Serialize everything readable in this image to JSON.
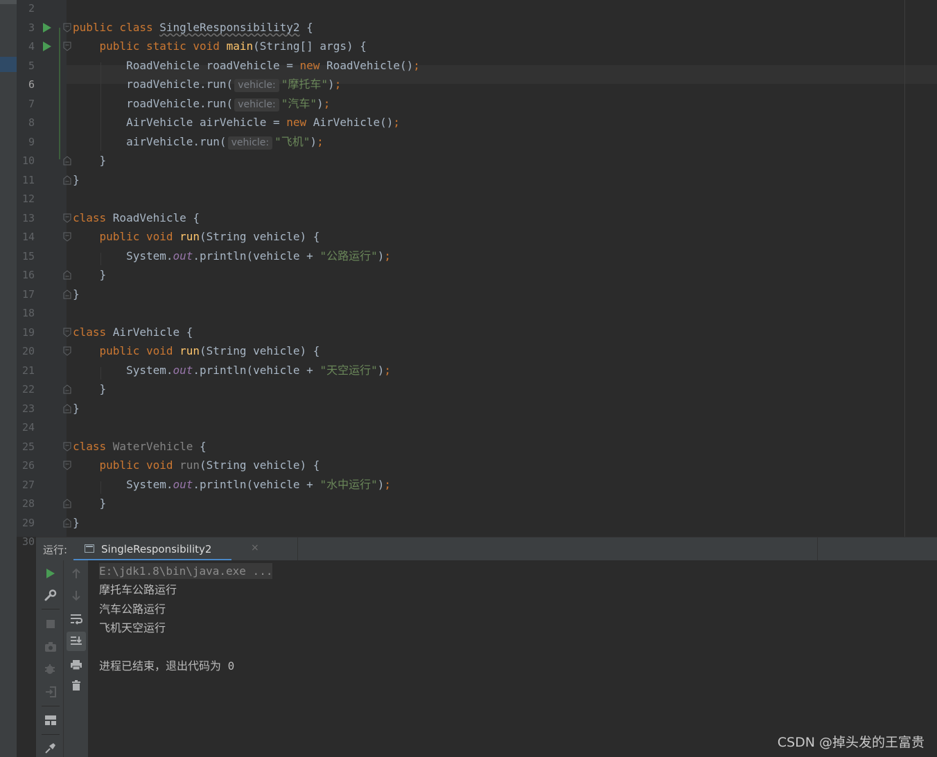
{
  "editor": {
    "current_line": "6",
    "lines": [
      {
        "num": "2"
      },
      {
        "num": "3",
        "parts": [
          {
            "t": "public class ",
            "c": "kw"
          },
          {
            "t": "SingleResponsibility2",
            "c": "err-underline"
          },
          {
            "t": " {",
            "c": ""
          }
        ]
      },
      {
        "num": "4",
        "parts": [
          {
            "t": "    public static void ",
            "c": "kw"
          },
          {
            "t": "main",
            "c": "fn"
          },
          {
            "t": "(String[] args) {",
            "c": ""
          }
        ]
      },
      {
        "num": "5",
        "parts": [
          {
            "t": "        RoadVehicle roadVehicle = ",
            "c": ""
          },
          {
            "t": "new ",
            "c": "kw"
          },
          {
            "t": "RoadVehicle()",
            "c": ""
          },
          {
            "t": ";",
            "c": "semi"
          }
        ]
      },
      {
        "num": "6",
        "parts": [
          {
            "t": "        roadVehicle.run(",
            "c": ""
          },
          {
            "hint": "vehicle:"
          },
          {
            "t": "\"摩托车\"",
            "c": "str"
          },
          {
            "t": ")",
            "c": ""
          },
          {
            "t": ";",
            "c": "semi"
          }
        ]
      },
      {
        "num": "7",
        "parts": [
          {
            "t": "        roadVehicle.run(",
            "c": ""
          },
          {
            "hint": "vehicle:"
          },
          {
            "t": "\"汽车\"",
            "c": "str"
          },
          {
            "t": ")",
            "c": ""
          },
          {
            "t": ";",
            "c": "semi"
          }
        ]
      },
      {
        "num": "8",
        "parts": [
          {
            "t": "        AirVehicle airVehicle = ",
            "c": ""
          },
          {
            "t": "new ",
            "c": "kw"
          },
          {
            "t": "AirVehicle()",
            "c": ""
          },
          {
            "t": ";",
            "c": "semi"
          }
        ]
      },
      {
        "num": "9",
        "parts": [
          {
            "t": "        airVehicle.run(",
            "c": ""
          },
          {
            "hint": "vehicle:"
          },
          {
            "t": "\"飞机\"",
            "c": "str"
          },
          {
            "t": ")",
            "c": ""
          },
          {
            "t": ";",
            "c": "semi"
          }
        ]
      },
      {
        "num": "10",
        "parts": [
          {
            "t": "    }",
            "c": ""
          }
        ]
      },
      {
        "num": "11",
        "parts": [
          {
            "t": "}",
            "c": ""
          }
        ]
      },
      {
        "num": "12",
        "parts": []
      },
      {
        "num": "13",
        "parts": [
          {
            "t": "class ",
            "c": "kw"
          },
          {
            "t": "RoadVehicle {",
            "c": ""
          }
        ]
      },
      {
        "num": "14",
        "parts": [
          {
            "t": "    public void ",
            "c": "kw"
          },
          {
            "t": "run",
            "c": "fn"
          },
          {
            "t": "(String vehicle) {",
            "c": ""
          }
        ]
      },
      {
        "num": "15",
        "parts": [
          {
            "t": "        System.",
            "c": ""
          },
          {
            "t": "out",
            "c": "field"
          },
          {
            "t": ".println(vehicle + ",
            "c": ""
          },
          {
            "t": "\"公路运行\"",
            "c": "str"
          },
          {
            "t": ")",
            "c": ""
          },
          {
            "t": ";",
            "c": "semi"
          }
        ]
      },
      {
        "num": "16",
        "parts": [
          {
            "t": "    }",
            "c": ""
          }
        ]
      },
      {
        "num": "17",
        "parts": [
          {
            "t": "}",
            "c": ""
          }
        ]
      },
      {
        "num": "18",
        "parts": []
      },
      {
        "num": "19",
        "parts": [
          {
            "t": "class ",
            "c": "kw"
          },
          {
            "t": "AirVehicle {",
            "c": ""
          }
        ]
      },
      {
        "num": "20",
        "parts": [
          {
            "t": "    public void ",
            "c": "kw"
          },
          {
            "t": "run",
            "c": "fn"
          },
          {
            "t": "(String vehicle) {",
            "c": ""
          }
        ]
      },
      {
        "num": "21",
        "parts": [
          {
            "t": "        System.",
            "c": ""
          },
          {
            "t": "out",
            "c": "field"
          },
          {
            "t": ".println(vehicle + ",
            "c": ""
          },
          {
            "t": "\"天空运行\"",
            "c": "str"
          },
          {
            "t": ")",
            "c": ""
          },
          {
            "t": ";",
            "c": "semi"
          }
        ]
      },
      {
        "num": "22",
        "parts": [
          {
            "t": "    }",
            "c": ""
          }
        ]
      },
      {
        "num": "23",
        "parts": [
          {
            "t": "}",
            "c": ""
          }
        ]
      },
      {
        "num": "24",
        "parts": []
      },
      {
        "num": "25",
        "parts": [
          {
            "t": "class ",
            "c": "kw"
          },
          {
            "t": "WaterVehicle",
            "c": "cls-dim"
          },
          {
            "t": " {",
            "c": ""
          }
        ]
      },
      {
        "num": "26",
        "parts": [
          {
            "t": "    public void ",
            "c": "kw"
          },
          {
            "t": "run",
            "c": "cls-dim"
          },
          {
            "t": "(String vehicle) {",
            "c": ""
          }
        ]
      },
      {
        "num": "27",
        "parts": [
          {
            "t": "        System.",
            "c": ""
          },
          {
            "t": "out",
            "c": "field"
          },
          {
            "t": ".println(vehicle + ",
            "c": ""
          },
          {
            "t": "\"水中运行\"",
            "c": "str"
          },
          {
            "t": ")",
            "c": ""
          },
          {
            "t": ";",
            "c": "semi"
          }
        ]
      },
      {
        "num": "28",
        "parts": [
          {
            "t": "    }",
            "c": ""
          }
        ]
      },
      {
        "num": "29",
        "parts": [
          {
            "t": "}",
            "c": ""
          }
        ]
      },
      {
        "num": "30"
      }
    ]
  },
  "run_panel": {
    "label": "运行:",
    "tab_label": "SingleResponsibility2",
    "tab_close": "×",
    "toolbar_left": [
      "rerun-icon",
      "wrench-icon",
      "stop-icon",
      "camera-icon",
      "debug-icon",
      "login-icon",
      "layout-icon",
      "pin-icon"
    ],
    "toolbar_right": [
      "arrow-up-icon",
      "arrow-down-icon",
      "soft-wrap-icon",
      "scroll-to-end-icon",
      "print-icon",
      "trash-icon"
    ]
  },
  "console": {
    "command": "E:\\jdk1.8\\bin\\java.exe ...",
    "output": [
      "摩托车公路运行",
      "汽车公路运行",
      "飞机天空运行",
      "",
      "进程已结束，退出代码为 0"
    ]
  },
  "watermark": "CSDN @掉头发的王富贵",
  "colors": {
    "background": "#2b2b2b",
    "keyword": "#cc7832",
    "string": "#6a8759",
    "function": "#ffc66d",
    "static_field": "#9876aa",
    "run_green": "#499c54",
    "tab_underline": "#4a88c7"
  }
}
